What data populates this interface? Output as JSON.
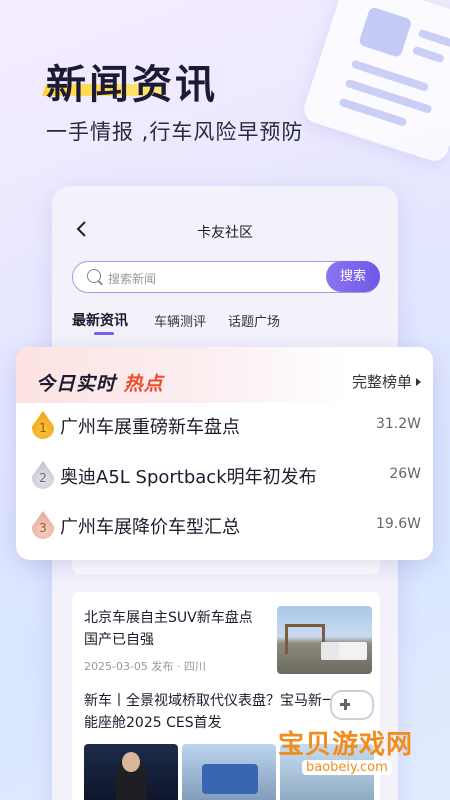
{
  "hero": {
    "title": "新闻资讯",
    "subtitle": "一手情报 ,行车风险早预防"
  },
  "app": {
    "nav_title": "卡友社区",
    "back_icon": "chevron-left-icon",
    "search": {
      "placeholder": "搜索新闻",
      "button_label": "搜索"
    },
    "tabs": [
      {
        "label": "最新资讯",
        "active": true
      },
      {
        "label": "车辆测评",
        "active": false
      },
      {
        "label": "话题广场",
        "active": false
      }
    ]
  },
  "hot": {
    "title_prefix": "今日实时",
    "title_accent": "热点",
    "more_label": "完整榜单",
    "accent_color": "#f04b2b",
    "items": [
      {
        "rank": "1",
        "text": "广州车展重磅新车盘点",
        "count": "31.2W"
      },
      {
        "rank": "2",
        "text": "奥迪A5L Sportback明年初发布",
        "count": "26W"
      },
      {
        "rank": "3",
        "text": "广州车展降价车型汇总",
        "count": "19.6W"
      }
    ]
  },
  "news": [
    {
      "title": "北京车展自主SUV新车盘点 国产已自强",
      "meta": "2025-03-05 发布 · 四川"
    },
    {
      "title": "新车丨全景视域桥取代仪表盘？宝马新一代智能座舱2025 CES首发"
    }
  ],
  "watermark": {
    "text": "宝贝游戏网",
    "url": "baobeiy.com"
  },
  "colors": {
    "primary": "#7b62ea",
    "hot_red": "#f04b2b",
    "watermark": "#f28c1d"
  }
}
